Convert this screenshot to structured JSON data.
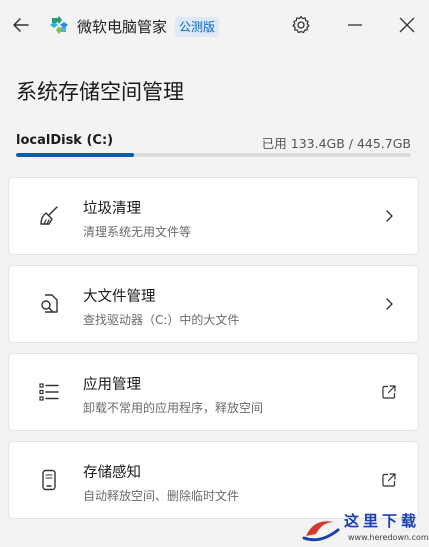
{
  "titlebar": {
    "app_name": "微软电脑管家",
    "badge": "公测版"
  },
  "page": {
    "title": "系统存储空间管理"
  },
  "disk": {
    "name": "localDisk (C:)",
    "usage": "已用 133.4GB / 445.7GB",
    "used_fraction": 0.2993,
    "bar_color": "#0b5cad"
  },
  "cards": [
    {
      "title": "垃圾清理",
      "subtitle": "清理系统无用文件等",
      "icon": "broom-icon",
      "trailing": "chevron-right-icon"
    },
    {
      "title": "大文件管理",
      "subtitle": "查找驱动器（C:）中的大文件",
      "icon": "file-search-icon",
      "trailing": "chevron-right-icon"
    },
    {
      "title": "应用管理",
      "subtitle": "卸载不常用的应用程序，释放空间",
      "icon": "list-icon",
      "trailing": "external-link-icon"
    },
    {
      "title": "存储感知",
      "subtitle": "自动释放空间、删除临时文件",
      "icon": "phone-icon",
      "trailing": "external-link-icon"
    }
  ],
  "watermark": {
    "text": "这里下载",
    "url": "www.heredown.com"
  },
  "colors": {
    "accent": "#0b5cad",
    "background": "#f3f3f3",
    "card": "#ffffff"
  }
}
